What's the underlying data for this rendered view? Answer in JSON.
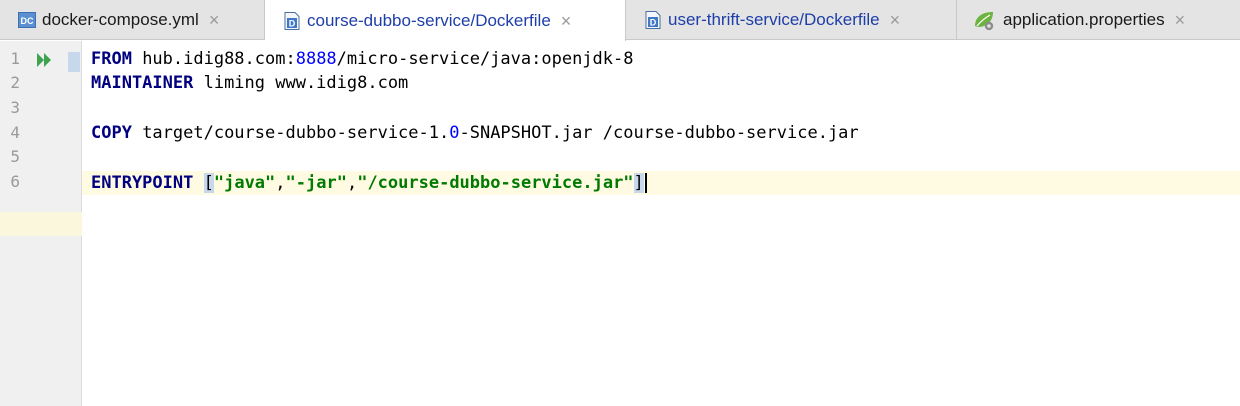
{
  "tabs": [
    {
      "label": "docker-compose.yml",
      "icon": "docker-compose-icon",
      "active": false
    },
    {
      "label": "course-dubbo-service/Dockerfile",
      "icon": "dockerfile-icon",
      "active": true
    },
    {
      "label": "user-thrift-service/Dockerfile",
      "icon": "dockerfile-icon",
      "active": false
    },
    {
      "label": "application.properties",
      "icon": "spring-leaf-icon",
      "active": false
    }
  ],
  "close_glyph": "×",
  "line_numbers": [
    "1",
    "2",
    "3",
    "4",
    "5",
    "6"
  ],
  "current_line": 6,
  "code": {
    "l1_kw": "FROM",
    "l1_a": " hub.idig88.com:",
    "l1_num": "8888",
    "l1_b": "/micro-service/java:openjdk-8",
    "l2_kw": "MAINTAINER",
    "l2_rest": " liming www.idig8.com",
    "l4_kw": "COPY",
    "l4_a": " target/course-dubbo-service-1.",
    "l4_num": "0",
    "l4_b": "-SNAPSHOT.jar /course-dubbo-service.jar",
    "l6_kw": "ENTRYPOINT",
    "l6_open": "[",
    "l6_s1": "\"java\"",
    "l6_c1": ",",
    "l6_s2": "\"-jar\"",
    "l6_c2": ",",
    "l6_s3": "\"/course-dubbo-service.jar\"",
    "l6_close": "]"
  },
  "colors": {
    "keyword": "#000080",
    "number": "#0000ff",
    "string": "#007a00",
    "current_line": "#fffbe3",
    "active_tab_text": "#1e3ea8"
  }
}
